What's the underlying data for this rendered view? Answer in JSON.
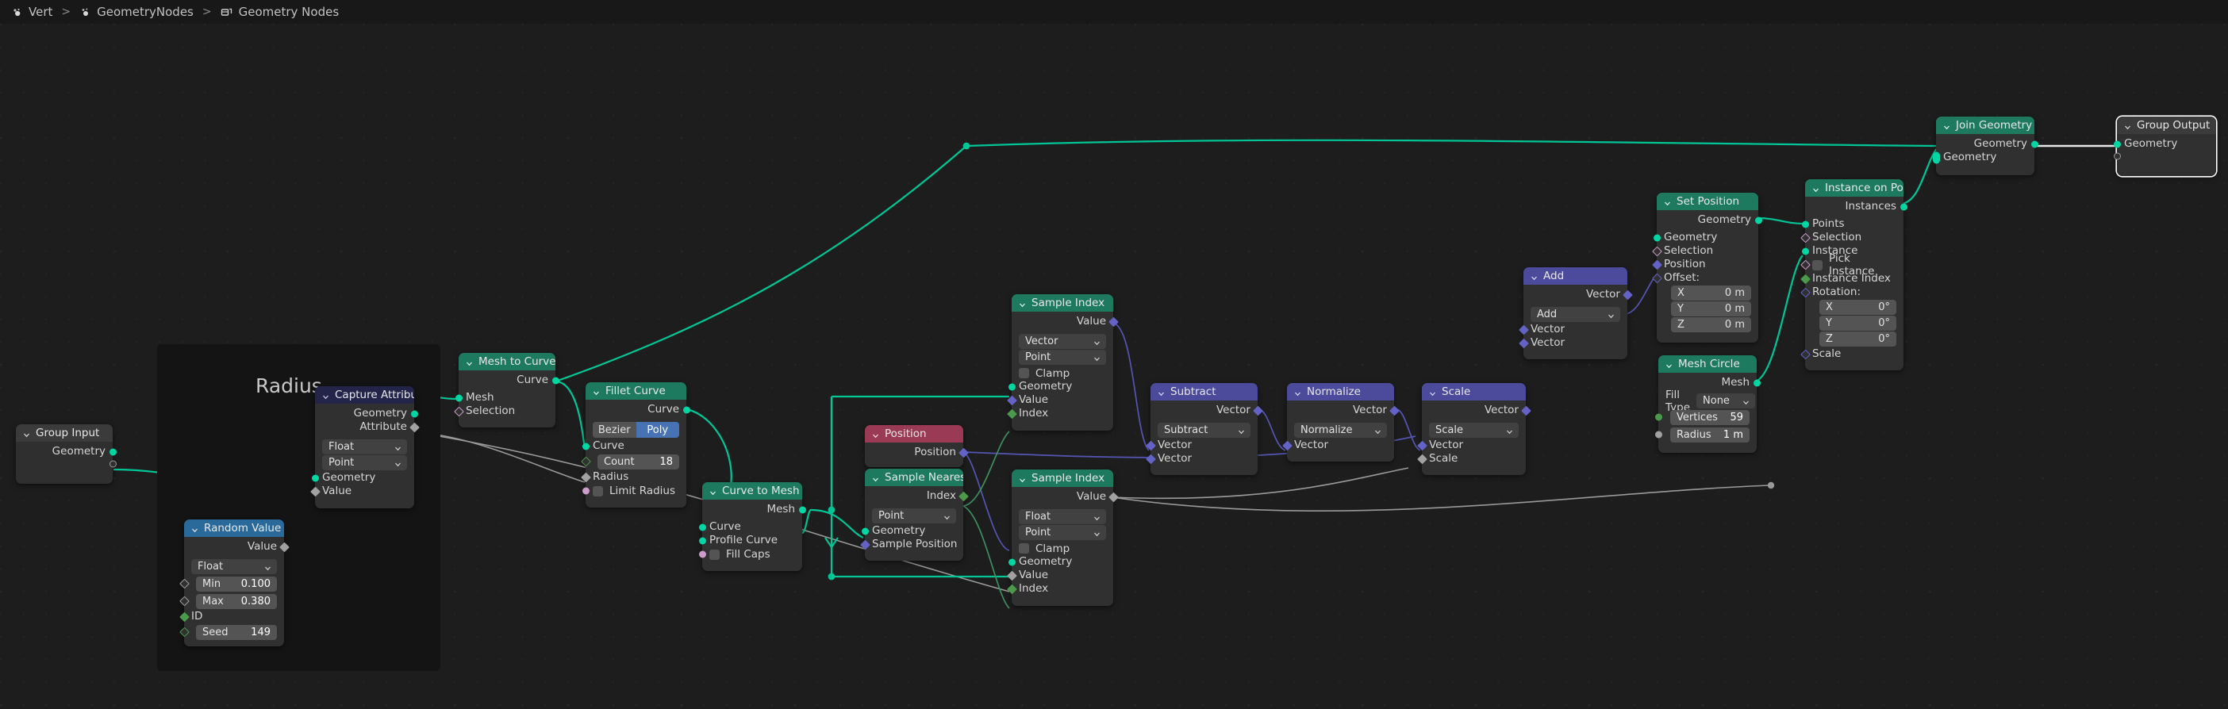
{
  "app": {
    "breadcrumb": [
      {
        "label": "Vert",
        "icon": "object-icon"
      },
      {
        "label": "GeometryNodes",
        "icon": "modifier-icon"
      },
      {
        "label": "Geometry Nodes",
        "icon": "geometry-nodes-icon"
      }
    ],
    "separator": ">"
  },
  "colors": {
    "background": "#1d1d1d",
    "topbar": "#181818",
    "geometry_header": "#1d7a5f",
    "attribute_header": "#222449",
    "vector_header": "#4b4a9b",
    "input_header": "#9a3a54",
    "random_header": "#2a6a9b",
    "node_body": "#303030",
    "geometry_socket": "#00d6a3",
    "vector_socket": "#6363c7",
    "float_socket": "#a1a1a1",
    "int_socket": "#4a9a4a",
    "bool_socket": "#cc9ccc",
    "wire_geometry": "#00c697",
    "wire_field": "#9a9a9a",
    "wire_vector": "#5555b5",
    "wire_int": "#3f8f5f",
    "wire_white": "#e6e6e6",
    "toggle_active": "#4772b3"
  },
  "frames": [
    {
      "label": "Radius"
    }
  ],
  "nodes": {
    "group_input": {
      "title": "Group Input",
      "outputs": [
        "Geometry",
        ""
      ]
    },
    "random_value": {
      "title": "Random Value",
      "outputs": [
        "Value"
      ],
      "data_type": "Float",
      "fields": [
        {
          "key": "Min",
          "value": "0.100"
        },
        {
          "key": "Max",
          "value": "0.380"
        }
      ],
      "id_label": "ID",
      "seed": {
        "key": "Seed",
        "value": "149"
      }
    },
    "capture_attribute": {
      "title": "Capture Attribute",
      "outputs": [
        "Geometry",
        "Attribute"
      ],
      "data_type": "Float",
      "domain": "Point",
      "inputs": [
        "Geometry",
        "Value"
      ]
    },
    "mesh_to_curve": {
      "title": "Mesh to Curve",
      "outputs": [
        "Curve"
      ],
      "inputs": [
        "Mesh",
        "Selection"
      ]
    },
    "fillet_curve": {
      "title": "Fillet Curve",
      "outputs": [
        "Curve"
      ],
      "mode_options": [
        "Bezier",
        "Poly"
      ],
      "mode_selected": "Poly",
      "inputs": [
        "Curve"
      ],
      "count": {
        "key": "Count",
        "value": "18"
      },
      "radius_label": "Radius",
      "limit_radius_label": "Limit Radius"
    },
    "curve_to_mesh": {
      "title": "Curve to Mesh",
      "outputs": [
        "Mesh"
      ],
      "inputs": [
        "Curve",
        "Profile Curve"
      ],
      "fill_caps_label": "Fill Caps"
    },
    "position": {
      "title": "Position",
      "outputs": [
        "Position"
      ]
    },
    "sample_nearest": {
      "title": "Sample Nearest",
      "outputs": [
        "Index"
      ],
      "domain": "Point",
      "inputs": [
        "Geometry",
        "Sample Position"
      ]
    },
    "sample_index_top": {
      "title": "Sample Index",
      "outputs": [
        "Value"
      ],
      "data_type": "Vector",
      "domain": "Point",
      "clamp_label": "Clamp",
      "inputs": [
        "Geometry",
        "Value",
        "Index"
      ]
    },
    "sample_index_bottom": {
      "title": "Sample Index",
      "outputs": [
        "Value"
      ],
      "data_type": "Float",
      "domain": "Point",
      "clamp_label": "Clamp",
      "inputs": [
        "Geometry",
        "Value",
        "Index"
      ]
    },
    "subtract": {
      "title": "Subtract",
      "outputs": [
        "Vector"
      ],
      "operation": "Subtract",
      "inputs": [
        "Vector",
        "Vector"
      ]
    },
    "normalize": {
      "title": "Normalize",
      "outputs": [
        "Vector"
      ],
      "operation": "Normalize",
      "inputs": [
        "Vector"
      ]
    },
    "scale": {
      "title": "Scale",
      "outputs": [
        "Vector"
      ],
      "operation": "Scale",
      "inputs": [
        "Vector",
        "Scale"
      ]
    },
    "add": {
      "title": "Add",
      "outputs": [
        "Vector"
      ],
      "operation": "Add",
      "inputs": [
        "Vector",
        "Vector"
      ]
    },
    "set_position": {
      "title": "Set Position",
      "outputs": [
        "Geometry"
      ],
      "inputs": [
        "Geometry",
        "Selection",
        "Position"
      ],
      "offset_label": "Offset:",
      "offset": [
        {
          "axis": "X",
          "value": "0 m"
        },
        {
          "axis": "Y",
          "value": "0 m"
        },
        {
          "axis": "Z",
          "value": "0 m"
        }
      ]
    },
    "mesh_circle": {
      "title": "Mesh Circle",
      "outputs": [
        "Mesh"
      ],
      "fill_type_label": "Fill Type",
      "fill_type": "None",
      "fields": [
        {
          "key": "Vertices",
          "value": "59"
        },
        {
          "key": "Radius",
          "value": "1 m"
        }
      ]
    },
    "instance_on_points": {
      "title": "Instance on Points",
      "outputs": [
        "Instances"
      ],
      "inputs": [
        "Points",
        "Selection",
        "Instance"
      ],
      "pick_instance_label": "Pick Instance",
      "instance_index_label": "Instance Index",
      "rotation_label": "Rotation:",
      "rotation": [
        {
          "axis": "X",
          "value": "0°"
        },
        {
          "axis": "Y",
          "value": "0°"
        },
        {
          "axis": "Z",
          "value": "0°"
        }
      ],
      "scale_label": "Scale"
    },
    "join_geometry": {
      "title": "Join Geometry",
      "outputs": [
        "Geometry"
      ],
      "inputs": [
        "Geometry"
      ]
    },
    "group_output": {
      "title": "Group Output",
      "inputs": [
        "Geometry",
        ""
      ]
    }
  }
}
